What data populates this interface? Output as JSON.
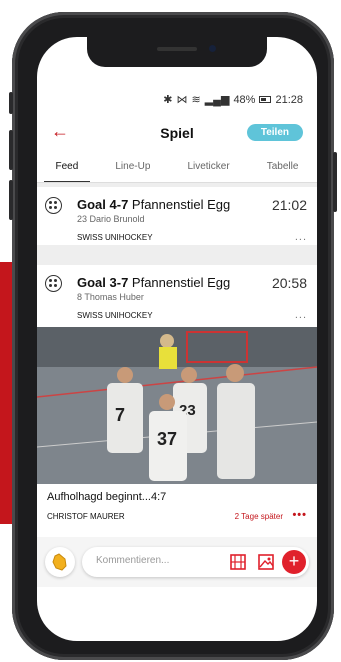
{
  "status_bar": {
    "icons": [
      "bluetooth-icon",
      "vibrate-icon",
      "wifi-icon",
      "signal-icon"
    ],
    "battery": "48%",
    "time": "21:28"
  },
  "header": {
    "title": "Spiel",
    "share_label": "Teilen",
    "accent_color": "#c4161c",
    "share_color": "#5fc4d9"
  },
  "tabs": [
    {
      "label": "Feed",
      "active": true
    },
    {
      "label": "Line-Up",
      "active": false
    },
    {
      "label": "Liveticker",
      "active": false
    },
    {
      "label": "Tabelle",
      "active": false
    }
  ],
  "feed": {
    "cards": [
      {
        "goal_label": "Goal 4-7",
        "team": "Pfannenstiel Egg",
        "player": "23 Dario Brunold",
        "time": "21:02",
        "source": "SWISS UNIHOCKEY",
        "more": "..."
      },
      {
        "goal_label": "Goal 3-7",
        "team": "Pfannenstiel Egg",
        "player": "8 Thomas Huber",
        "time": "20:58",
        "source": "SWISS UNIHOCKEY",
        "more": "..."
      }
    ],
    "post": {
      "caption": "Aufholhagd beginnt...4:7",
      "author": "CHRISTOF MAURER",
      "ago": "2 Tage später",
      "more": "•••",
      "jersey_numbers": [
        "7",
        "23",
        "37"
      ]
    }
  },
  "comment_bar": {
    "placeholder": "Kommentieren...",
    "icons": [
      "clap-icon",
      "film-icon",
      "image-icon",
      "plus-icon"
    ]
  }
}
